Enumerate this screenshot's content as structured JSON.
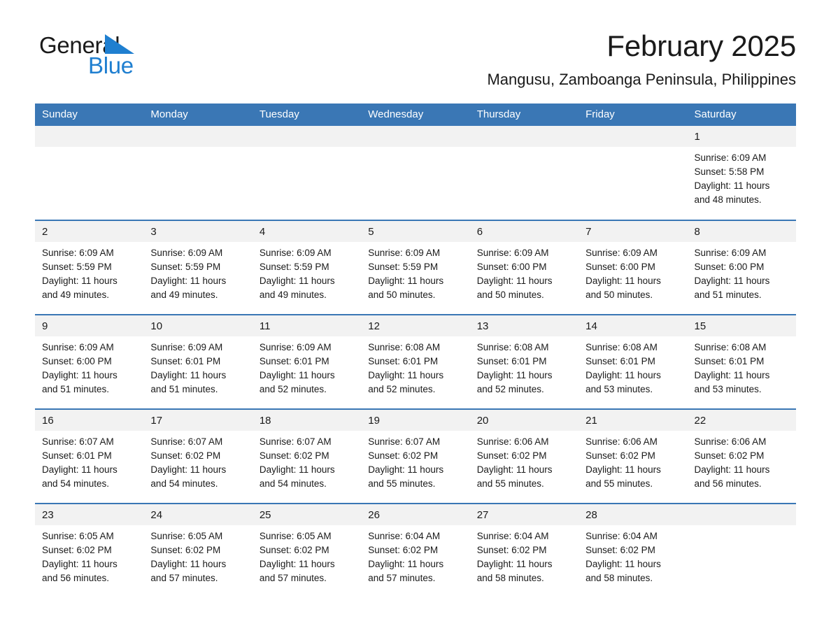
{
  "brand": {
    "name_part1": "General",
    "name_part2": "Blue",
    "triangle_icon": "triangle-icon",
    "accent_color": "#1f7fd0"
  },
  "header": {
    "title": "February 2025",
    "subtitle": "Mangusu, Zamboanga Peninsula, Philippines"
  },
  "colors": {
    "header_blue": "#3a77b5",
    "daynum_band": "#f2f2f2",
    "text": "#1a1a1a"
  },
  "weekday_headers": [
    "Sunday",
    "Monday",
    "Tuesday",
    "Wednesday",
    "Thursday",
    "Friday",
    "Saturday"
  ],
  "weeks": [
    [
      {
        "day": "",
        "empty": true,
        "sunrise": "",
        "sunset": "",
        "daylight_line1": "",
        "daylight_line2": ""
      },
      {
        "day": "",
        "empty": true,
        "sunrise": "",
        "sunset": "",
        "daylight_line1": "",
        "daylight_line2": ""
      },
      {
        "day": "",
        "empty": true,
        "sunrise": "",
        "sunset": "",
        "daylight_line1": "",
        "daylight_line2": ""
      },
      {
        "day": "",
        "empty": true,
        "sunrise": "",
        "sunset": "",
        "daylight_line1": "",
        "daylight_line2": ""
      },
      {
        "day": "",
        "empty": true,
        "sunrise": "",
        "sunset": "",
        "daylight_line1": "",
        "daylight_line2": ""
      },
      {
        "day": "",
        "empty": true,
        "sunrise": "",
        "sunset": "",
        "daylight_line1": "",
        "daylight_line2": ""
      },
      {
        "day": "1",
        "empty": false,
        "sunrise": "Sunrise: 6:09 AM",
        "sunset": "Sunset: 5:58 PM",
        "daylight_line1": "Daylight: 11 hours",
        "daylight_line2": "and 48 minutes."
      }
    ],
    [
      {
        "day": "2",
        "empty": false,
        "sunrise": "Sunrise: 6:09 AM",
        "sunset": "Sunset: 5:59 PM",
        "daylight_line1": "Daylight: 11 hours",
        "daylight_line2": "and 49 minutes."
      },
      {
        "day": "3",
        "empty": false,
        "sunrise": "Sunrise: 6:09 AM",
        "sunset": "Sunset: 5:59 PM",
        "daylight_line1": "Daylight: 11 hours",
        "daylight_line2": "and 49 minutes."
      },
      {
        "day": "4",
        "empty": false,
        "sunrise": "Sunrise: 6:09 AM",
        "sunset": "Sunset: 5:59 PM",
        "daylight_line1": "Daylight: 11 hours",
        "daylight_line2": "and 49 minutes."
      },
      {
        "day": "5",
        "empty": false,
        "sunrise": "Sunrise: 6:09 AM",
        "sunset": "Sunset: 5:59 PM",
        "daylight_line1": "Daylight: 11 hours",
        "daylight_line2": "and 50 minutes."
      },
      {
        "day": "6",
        "empty": false,
        "sunrise": "Sunrise: 6:09 AM",
        "sunset": "Sunset: 6:00 PM",
        "daylight_line1": "Daylight: 11 hours",
        "daylight_line2": "and 50 minutes."
      },
      {
        "day": "7",
        "empty": false,
        "sunrise": "Sunrise: 6:09 AM",
        "sunset": "Sunset: 6:00 PM",
        "daylight_line1": "Daylight: 11 hours",
        "daylight_line2": "and 50 minutes."
      },
      {
        "day": "8",
        "empty": false,
        "sunrise": "Sunrise: 6:09 AM",
        "sunset": "Sunset: 6:00 PM",
        "daylight_line1": "Daylight: 11 hours",
        "daylight_line2": "and 51 minutes."
      }
    ],
    [
      {
        "day": "9",
        "empty": false,
        "sunrise": "Sunrise: 6:09 AM",
        "sunset": "Sunset: 6:00 PM",
        "daylight_line1": "Daylight: 11 hours",
        "daylight_line2": "and 51 minutes."
      },
      {
        "day": "10",
        "empty": false,
        "sunrise": "Sunrise: 6:09 AM",
        "sunset": "Sunset: 6:01 PM",
        "daylight_line1": "Daylight: 11 hours",
        "daylight_line2": "and 51 minutes."
      },
      {
        "day": "11",
        "empty": false,
        "sunrise": "Sunrise: 6:09 AM",
        "sunset": "Sunset: 6:01 PM",
        "daylight_line1": "Daylight: 11 hours",
        "daylight_line2": "and 52 minutes."
      },
      {
        "day": "12",
        "empty": false,
        "sunrise": "Sunrise: 6:08 AM",
        "sunset": "Sunset: 6:01 PM",
        "daylight_line1": "Daylight: 11 hours",
        "daylight_line2": "and 52 minutes."
      },
      {
        "day": "13",
        "empty": false,
        "sunrise": "Sunrise: 6:08 AM",
        "sunset": "Sunset: 6:01 PM",
        "daylight_line1": "Daylight: 11 hours",
        "daylight_line2": "and 52 minutes."
      },
      {
        "day": "14",
        "empty": false,
        "sunrise": "Sunrise: 6:08 AM",
        "sunset": "Sunset: 6:01 PM",
        "daylight_line1": "Daylight: 11 hours",
        "daylight_line2": "and 53 minutes."
      },
      {
        "day": "15",
        "empty": false,
        "sunrise": "Sunrise: 6:08 AM",
        "sunset": "Sunset: 6:01 PM",
        "daylight_line1": "Daylight: 11 hours",
        "daylight_line2": "and 53 minutes."
      }
    ],
    [
      {
        "day": "16",
        "empty": false,
        "sunrise": "Sunrise: 6:07 AM",
        "sunset": "Sunset: 6:01 PM",
        "daylight_line1": "Daylight: 11 hours",
        "daylight_line2": "and 54 minutes."
      },
      {
        "day": "17",
        "empty": false,
        "sunrise": "Sunrise: 6:07 AM",
        "sunset": "Sunset: 6:02 PM",
        "daylight_line1": "Daylight: 11 hours",
        "daylight_line2": "and 54 minutes."
      },
      {
        "day": "18",
        "empty": false,
        "sunrise": "Sunrise: 6:07 AM",
        "sunset": "Sunset: 6:02 PM",
        "daylight_line1": "Daylight: 11 hours",
        "daylight_line2": "and 54 minutes."
      },
      {
        "day": "19",
        "empty": false,
        "sunrise": "Sunrise: 6:07 AM",
        "sunset": "Sunset: 6:02 PM",
        "daylight_line1": "Daylight: 11 hours",
        "daylight_line2": "and 55 minutes."
      },
      {
        "day": "20",
        "empty": false,
        "sunrise": "Sunrise: 6:06 AM",
        "sunset": "Sunset: 6:02 PM",
        "daylight_line1": "Daylight: 11 hours",
        "daylight_line2": "and 55 minutes."
      },
      {
        "day": "21",
        "empty": false,
        "sunrise": "Sunrise: 6:06 AM",
        "sunset": "Sunset: 6:02 PM",
        "daylight_line1": "Daylight: 11 hours",
        "daylight_line2": "and 55 minutes."
      },
      {
        "day": "22",
        "empty": false,
        "sunrise": "Sunrise: 6:06 AM",
        "sunset": "Sunset: 6:02 PM",
        "daylight_line1": "Daylight: 11 hours",
        "daylight_line2": "and 56 minutes."
      }
    ],
    [
      {
        "day": "23",
        "empty": false,
        "sunrise": "Sunrise: 6:05 AM",
        "sunset": "Sunset: 6:02 PM",
        "daylight_line1": "Daylight: 11 hours",
        "daylight_line2": "and 56 minutes."
      },
      {
        "day": "24",
        "empty": false,
        "sunrise": "Sunrise: 6:05 AM",
        "sunset": "Sunset: 6:02 PM",
        "daylight_line1": "Daylight: 11 hours",
        "daylight_line2": "and 57 minutes."
      },
      {
        "day": "25",
        "empty": false,
        "sunrise": "Sunrise: 6:05 AM",
        "sunset": "Sunset: 6:02 PM",
        "daylight_line1": "Daylight: 11 hours",
        "daylight_line2": "and 57 minutes."
      },
      {
        "day": "26",
        "empty": false,
        "sunrise": "Sunrise: 6:04 AM",
        "sunset": "Sunset: 6:02 PM",
        "daylight_line1": "Daylight: 11 hours",
        "daylight_line2": "and 57 minutes."
      },
      {
        "day": "27",
        "empty": false,
        "sunrise": "Sunrise: 6:04 AM",
        "sunset": "Sunset: 6:02 PM",
        "daylight_line1": "Daylight: 11 hours",
        "daylight_line2": "and 58 minutes."
      },
      {
        "day": "28",
        "empty": false,
        "sunrise": "Sunrise: 6:04 AM",
        "sunset": "Sunset: 6:02 PM",
        "daylight_line1": "Daylight: 11 hours",
        "daylight_line2": "and 58 minutes."
      },
      {
        "day": "",
        "empty": true,
        "sunrise": "",
        "sunset": "",
        "daylight_line1": "",
        "daylight_line2": ""
      }
    ]
  ]
}
